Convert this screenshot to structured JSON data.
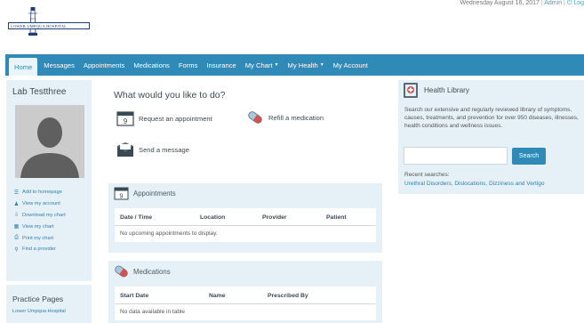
{
  "header": {
    "logo_text": "LOWER UMPQUA HOSPITAL",
    "date": "Wednesday August 16, 2017",
    "help_label": "Admin",
    "logout_label": "Log"
  },
  "nav": {
    "items": [
      {
        "label": "Home",
        "active": true
      },
      {
        "label": "Messages"
      },
      {
        "label": "Appointments"
      },
      {
        "label": "Medications"
      },
      {
        "label": "Forms"
      },
      {
        "label": "Insurance"
      },
      {
        "label": "My Chart",
        "dropdown": true
      },
      {
        "label": "My Health",
        "dropdown": true
      },
      {
        "label": "My Account"
      }
    ]
  },
  "sidebar": {
    "user_name": "Lab Testthree",
    "links": [
      {
        "label": "Add to homepage",
        "icon": "list-icon"
      },
      {
        "label": "View my account",
        "icon": "user-icon"
      },
      {
        "label": "Download my chart",
        "icon": "download-icon"
      },
      {
        "label": "View my chart",
        "icon": "chart-icon"
      },
      {
        "label": "Print my chart",
        "icon": "print-icon"
      },
      {
        "label": "Find a provider",
        "icon": "search-icon"
      }
    ],
    "practice_title": "Practice Pages",
    "practice_link": "Lower Umpqua Hospital"
  },
  "main": {
    "title": "What would you like to do?",
    "actions": {
      "request": "Request an appointment",
      "refill": "Refill a medication",
      "message": "Send a message"
    },
    "appointments": {
      "title": "Appointments",
      "columns": [
        "Date / Time",
        "Location",
        "Provider",
        "Patient"
      ],
      "empty": "No upcoming appointments to display."
    },
    "medications": {
      "title": "Medications",
      "columns": [
        "Start Date",
        "Name",
        "Prescribed By"
      ],
      "empty": "No data available in table"
    }
  },
  "library": {
    "title": "Health Library",
    "description": "Search our extensive and regularly reviewed library of symptoms, causes, treatments, and prevention for over 950 diseases, illnesses, health conditions and wellness issues.",
    "search_placeholder": "",
    "search_button": "Search",
    "recent_label": "Recent searches:",
    "recent_links": "Urethral Disorders, Dislocations, Dizziness and Vertigo"
  },
  "colors": {
    "nav_bg": "#2f8ab8",
    "panel_bg": "#e6f1f7",
    "link": "#2f7fb0"
  }
}
